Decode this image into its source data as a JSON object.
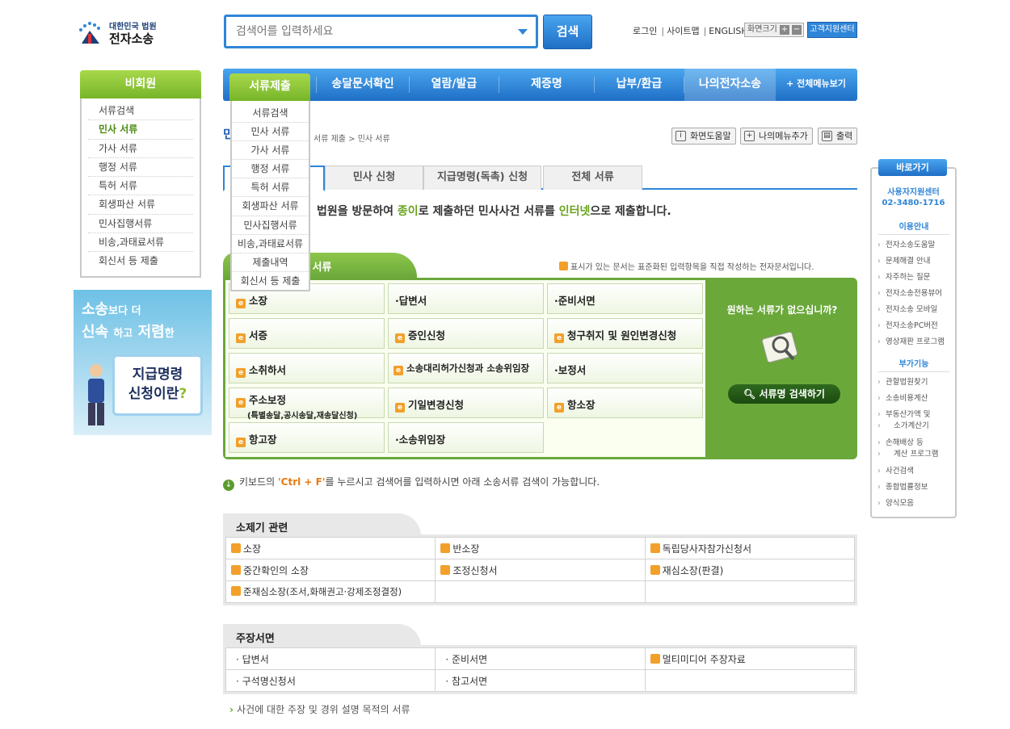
{
  "logo": {
    "line1": "대한민국 법원",
    "line2": "전자소송"
  },
  "search": {
    "placeholder": "검색어를 입력하세요",
    "button": "검색"
  },
  "util": {
    "login": "로그인",
    "sitemap": "사이트맵",
    "english": "ENGLISH",
    "zoom": "화면크기",
    "plus": "+",
    "minus": "−",
    "support": "고객지원센터"
  },
  "leftnav": {
    "header": "비회원",
    "items": [
      "서류검색",
      "민사 서류",
      "가사 서류",
      "행정 서류",
      "특허 서류",
      "회생파산 서류",
      "민사집행서류",
      "비송,과태료서류",
      "회신서 등 제출"
    ]
  },
  "banner": {
    "l1a": "소송",
    "l1b": "보다 더",
    "l2a": "신속",
    "l2b": "하고",
    "l2c": "저렴",
    "l2d": "한",
    "s1": "지급명령",
    "s2a": "신청이란",
    "s2b": "?"
  },
  "menu": {
    "active": "서류제출",
    "items": [
      "송달문서확인",
      "열람/발급",
      "제증명",
      "납부/환급",
      "나의전자소송"
    ],
    "all": "+ 전체메뉴보기",
    "dropdown": [
      "서류검색",
      "민사 서류",
      "가사 서류",
      "행정 서류",
      "특허 서류",
      "회생파산 서류",
      "민사집행서류",
      "비송,과태료서류",
      "제출내역",
      "회신서 등 제출"
    ]
  },
  "page": {
    "title": "민",
    "breadcrumb": "서류 제출 > 민사 서류"
  },
  "tools": {
    "help": "화면도움말",
    "mymenu": "나의메뉴추가",
    "print": "출력"
  },
  "tabs": [
    "민사 신청",
    "지급명령(독촉) 신청",
    "전체 서류"
  ],
  "desc": {
    "p1": "법원을 방문하여 ",
    "g1": "종이",
    "p2": "로 제출하던 민사사건 서류를 ",
    "g2": "인터넷",
    "p3": "으로 제출합니다."
  },
  "section": {
    "label": "안 서류",
    "note": "표시가 있는 문서는 표준화된 입력항목을 직접 작성하는 전자문서입니다.",
    "cells": [
      {
        "icon": "e",
        "text": "소장"
      },
      {
        "icon": "·",
        "text": "답변서"
      },
      {
        "icon": "·",
        "text": "준비서면"
      },
      {
        "icon": "e",
        "text": "서증"
      },
      {
        "icon": "e",
        "text": "증인신청"
      },
      {
        "icon": "e",
        "text": "청구취지 및 원인변경신청"
      },
      {
        "icon": "e",
        "text": "소취하서"
      },
      {
        "icon": "e",
        "text": "소송대리허가신청과 소송위임장"
      },
      {
        "icon": "·",
        "text": "보정서"
      },
      {
        "icon": "e",
        "text": "주소보정",
        "sub": "(특별송달,공시송달,재송달신청)"
      },
      {
        "icon": "e",
        "text": "기일변경신청"
      },
      {
        "icon": "e",
        "text": "항소장"
      },
      {
        "icon": "e",
        "text": "항고장"
      },
      {
        "icon": "·",
        "text": "소송위임장"
      }
    ],
    "nofind": "원하는 서류가 없으십니까?",
    "nofind_btn": "서류명 검색하기"
  },
  "hint": {
    "p1": "키보드의 ",
    "key": "'Ctrl + F'",
    "p2": "를 누르시고 검색어를 입력하시면 아래 소송서류 검색이 가능합니다."
  },
  "sec1": {
    "title": "소제기 관련",
    "rows": [
      [
        {
          "e": true,
          "t": "소장"
        },
        {
          "e": true,
          "t": "반소장"
        },
        {
          "e": true,
          "t": "독립당사자참가신청서"
        }
      ],
      [
        {
          "e": true,
          "t": "중간확인의 소장"
        },
        {
          "e": true,
          "t": "조정신청서"
        },
        {
          "e": true,
          "t": "재심소장(판결)"
        }
      ],
      [
        {
          "e": true,
          "t": "준재심소장(조서,화해권고·강제조정결정)"
        },
        {
          "e": false,
          "t": ""
        },
        {
          "e": false,
          "t": ""
        }
      ]
    ]
  },
  "sec2": {
    "title": "주장서면",
    "rows": [
      [
        {
          "e": false,
          "t": "· 답변서"
        },
        {
          "e": false,
          "t": "· 준비서면"
        },
        {
          "e": true,
          "t": "멀티미디어 주장자료"
        }
      ],
      [
        {
          "e": false,
          "t": "· 구석명신청서"
        },
        {
          "e": false,
          "t": "· 참고서면"
        },
        {
          "e": false,
          "t": ""
        }
      ]
    ],
    "note": "사건에 대한 주장 및 경위 설명 목적의 서류"
  },
  "quick": {
    "header": "바로가기",
    "center": "사용자지원센터",
    "phone": "02-3480-1716",
    "guide": "이용안내",
    "guide_items": [
      "전자소송도움말",
      "문제해결 안내",
      "자주하는 질문",
      "전자소송전용뷰어",
      "전자소송 모바일",
      "전자소송PC버전",
      "영상재판 프로그램"
    ],
    "extra": "부가기능",
    "extra_items": [
      "관할법원찾기",
      "소송비용계산",
      "부동산가액 및",
      "소가계산기",
      "손해배상 등",
      "계산 프로그램",
      "사건검색",
      "종합법률정보",
      "양식모음"
    ]
  }
}
